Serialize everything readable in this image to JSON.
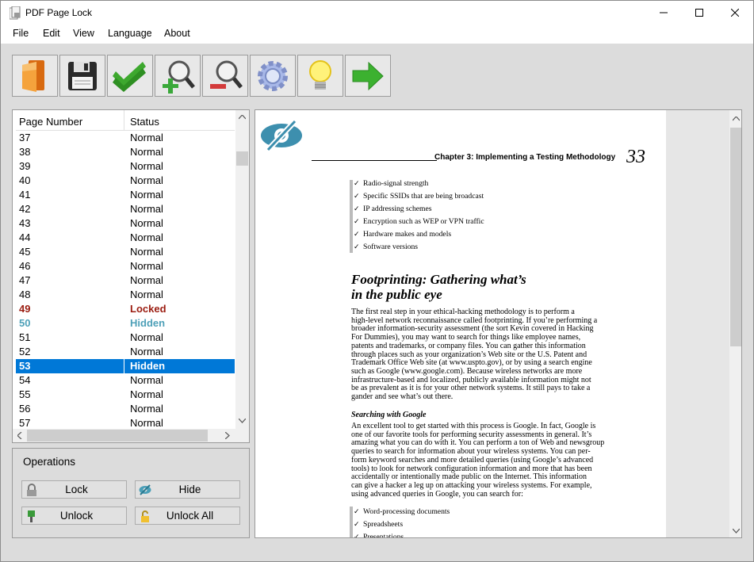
{
  "window": {
    "title": "PDF Page Lock",
    "controls": [
      "minimize",
      "maximize",
      "close"
    ]
  },
  "menu": [
    "File",
    "Edit",
    "View",
    "Language",
    "About"
  ],
  "toolbar": {
    "buttons": [
      "open-icon",
      "save-icon",
      "apply-icon",
      "zoom-in-icon",
      "zoom-out-icon",
      "settings-icon",
      "tip-icon",
      "next-icon"
    ]
  },
  "page_list": {
    "headers": {
      "page_number": "Page Number",
      "status": "Status"
    },
    "rows": [
      {
        "page": "37",
        "status": "Normal"
      },
      {
        "page": "38",
        "status": "Normal"
      },
      {
        "page": "39",
        "status": "Normal"
      },
      {
        "page": "40",
        "status": "Normal"
      },
      {
        "page": "41",
        "status": "Normal"
      },
      {
        "page": "42",
        "status": "Normal"
      },
      {
        "page": "43",
        "status": "Normal"
      },
      {
        "page": "44",
        "status": "Normal"
      },
      {
        "page": "45",
        "status": "Normal"
      },
      {
        "page": "46",
        "status": "Normal"
      },
      {
        "page": "47",
        "status": "Normal"
      },
      {
        "page": "48",
        "status": "Normal"
      },
      {
        "page": "49",
        "status": "Locked"
      },
      {
        "page": "50",
        "status": "Hidden"
      },
      {
        "page": "51",
        "status": "Normal"
      },
      {
        "page": "52",
        "status": "Normal"
      },
      {
        "page": "53",
        "status": "Hidden",
        "selected": true
      },
      {
        "page": "54",
        "status": "Normal"
      },
      {
        "page": "55",
        "status": "Normal"
      },
      {
        "page": "56",
        "status": "Normal"
      },
      {
        "page": "57",
        "status": "Normal"
      }
    ],
    "colors": {
      "locked": "#9b1c10",
      "hidden": "#4ea0b8",
      "selected": "#0078d7"
    }
  },
  "operations": {
    "legend": "Operations",
    "lock": "Lock",
    "hide": "Hide",
    "unlock": "Unlock",
    "unlock_all": "Unlock All"
  },
  "preview": {
    "chapter": "Chapter 3: Implementing a Testing Methodology",
    "page_number": "33",
    "bullets_top": [
      "Radio-signal strength",
      "Specific SSIDs that are being broadcast",
      "IP addressing schemes",
      "Encryption such as WEP or VPN traffic",
      "Hardware makes and models",
      "Software versions"
    ],
    "heading1": "Footprinting: Gathering what’s",
    "heading2": "in the public eye",
    "para1": [
      "The first real step in your ethical-hacking methodology is to perform a",
      "high-level network reconnaissance called footprinting. If you’re performing a",
      "broader information-security assessment (the sort Kevin covered in Hacking",
      "For Dummies), you may want to search for things like employee names,",
      "patents and trademarks, or company files. You can gather this information",
      "through places such as your organization’s Web site or the U.S. Patent and",
      "Trademark Office Web site (at www.uspto.gov), or by using a search engine",
      "such as Google (www.google.com). Because wireless networks are more",
      "infrastructure-based and localized, publicly available information might not",
      "be as prevalent as it is for your other network systems. It still pays to take a",
      "gander and see what’s out there."
    ],
    "subheading": "Searching with Google",
    "para2": [
      "An excellent tool to get started with this process is Google. In fact, Google is",
      "one of our favorite tools for performing security assessments in general. It’s",
      "amazing what you can do with it. You can perform a ton of Web and newsgroup",
      "queries to search for information about your wireless systems. You can per-",
      "form keyword searches and more detailed queries (using Google’s advanced",
      "tools) to look for network configuration information and more that has been",
      "accidentally or intentionally made public on the Internet. This information",
      "can give a hacker a leg up on attacking your wireless systems. For example,",
      "using advanced queries in Google, you can search for:"
    ],
    "bullets_bottom": [
      "Word-processing documents",
      "Spreadsheets",
      "Presentations"
    ]
  }
}
